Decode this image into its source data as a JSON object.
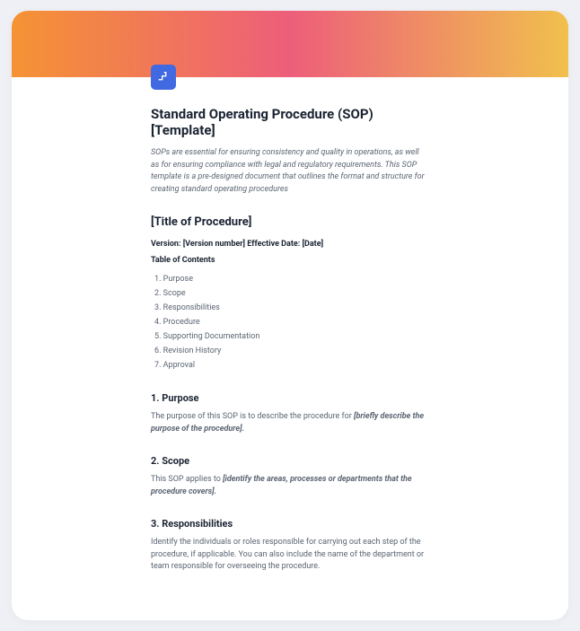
{
  "document": {
    "title": "Standard Operating Procedure (SOP) [Template]",
    "intro": "SOPs are essential for ensuring consistency and quality in operations, as well as for ensuring compliance with legal and regulatory requirements. This SOP template is a pre-designed document that outlines the format and structure for creating standard operating procedures",
    "procedure_title": "[Title of Procedure]",
    "meta_line": "Version: [Version number] Effective Date: [Date]",
    "toc_heading": "Table of Contents",
    "toc": [
      "Purpose",
      "Scope",
      "Responsibilities",
      "Procedure",
      "Supporting Documentation",
      "Revision History",
      "Approval"
    ],
    "sections": {
      "s1": {
        "heading": "1. Purpose",
        "body_prefix": "The purpose of this SOP is to describe the procedure for ",
        "placeholder": "[briefly describe the purpose of the procedure].",
        "body_suffix": ""
      },
      "s2": {
        "heading": "2. Scope",
        "body_prefix": "This SOP applies to ",
        "placeholder": "[identify the areas, processes or departments that the procedure covers].",
        "body_suffix": ""
      },
      "s3": {
        "heading": "3. Responsibilities",
        "body_prefix": "Identify the individuals or roles responsible for carrying out each step of the procedure, if applicable. You can also include the name of the department or team responsible for overseeing the procedure.",
        "placeholder": "",
        "body_suffix": ""
      }
    }
  }
}
